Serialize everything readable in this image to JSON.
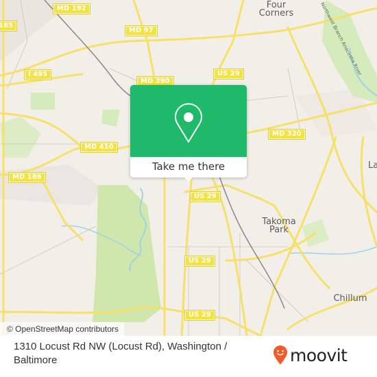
{
  "map": {
    "route_shields": [
      {
        "id": "md192",
        "label": "MD 192"
      },
      {
        "id": "i185",
        "label": "185"
      },
      {
        "id": "md97",
        "label": "MD 97"
      },
      {
        "id": "i495",
        "label": "I 495"
      },
      {
        "id": "md390",
        "label": "MD 390"
      },
      {
        "id": "us29a",
        "label": "US 29"
      },
      {
        "id": "md320",
        "label": "MD 320"
      },
      {
        "id": "md410",
        "label": "MD 410"
      },
      {
        "id": "md186",
        "label": "MD 186"
      },
      {
        "id": "us29b",
        "label": "US 29"
      },
      {
        "id": "us29c",
        "label": "US 29"
      },
      {
        "id": "us29d",
        "label": "US 29"
      }
    ],
    "places": [
      {
        "id": "four-corners",
        "line1": "Four",
        "line2": "Corners"
      },
      {
        "id": "takoma-park",
        "line1": "Takoma",
        "line2": "Park"
      },
      {
        "id": "chillum",
        "line1": "Chillum",
        "line2": ""
      },
      {
        "id": "la",
        "line1": "La",
        "line2": ""
      }
    ],
    "river_label": "Northwest Branch Anacostia River",
    "attribution": "© OpenStreetMap contributors",
    "colors": {
      "land": "#f2efe9",
      "park": "#cfe6ad",
      "road": "#f7e06a",
      "water": "#9fd2e6",
      "rail": "#777777"
    }
  },
  "popup": {
    "icon": "map-pin-icon",
    "cta_label": "Take me there",
    "accent": "#1fb96a"
  },
  "footer": {
    "address": "1310 Locust Rd NW (Locust Rd), Washington / Baltimore",
    "brand": "moovit",
    "brand_color": "#f15a29"
  }
}
